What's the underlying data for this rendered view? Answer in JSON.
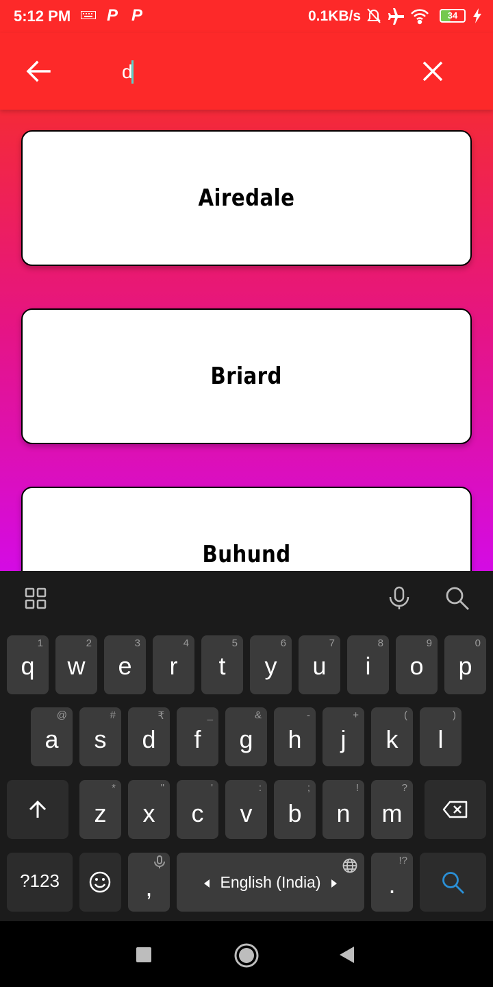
{
  "status_bar": {
    "time": "5:12 PM",
    "app_icon_1": "P",
    "app_icon_2": "P",
    "net_speed": "0.1KB/s",
    "battery": "34",
    "icons": [
      "keyboard-icon",
      "bell-off-icon",
      "airplane-icon",
      "wifi-icon",
      "battery-icon",
      "charging-icon"
    ]
  },
  "app_bar": {
    "search_value": "d",
    "background": "#fd2929"
  },
  "results": [
    "Airedale",
    "Briard",
    "Buhund"
  ],
  "keyboard": {
    "row1": [
      {
        "key": "q",
        "hint": "1"
      },
      {
        "key": "w",
        "hint": "2"
      },
      {
        "key": "e",
        "hint": "3"
      },
      {
        "key": "r",
        "hint": "4"
      },
      {
        "key": "t",
        "hint": "5"
      },
      {
        "key": "y",
        "hint": "6"
      },
      {
        "key": "u",
        "hint": "7"
      },
      {
        "key": "i",
        "hint": "8"
      },
      {
        "key": "o",
        "hint": "9"
      },
      {
        "key": "p",
        "hint": "0"
      }
    ],
    "row2": [
      {
        "key": "a",
        "hint": "@"
      },
      {
        "key": "s",
        "hint": "#"
      },
      {
        "key": "d",
        "hint": "₹"
      },
      {
        "key": "f",
        "hint": "_"
      },
      {
        "key": "g",
        "hint": "&"
      },
      {
        "key": "h",
        "hint": "-"
      },
      {
        "key": "j",
        "hint": "+"
      },
      {
        "key": "k",
        "hint": "("
      },
      {
        "key": "l",
        "hint": ")"
      }
    ],
    "row3": [
      {
        "key": "z",
        "hint": "*"
      },
      {
        "key": "x",
        "hint": "\""
      },
      {
        "key": "c",
        "hint": "'"
      },
      {
        "key": "v",
        "hint": ":"
      },
      {
        "key": "b",
        "hint": ";"
      },
      {
        "key": "n",
        "hint": "!"
      },
      {
        "key": "m",
        "hint": "?"
      }
    ],
    "symbols_label": "?123",
    "comma": ",",
    "period": ".",
    "period_hint": "!?",
    "space_label": "English (India)"
  }
}
